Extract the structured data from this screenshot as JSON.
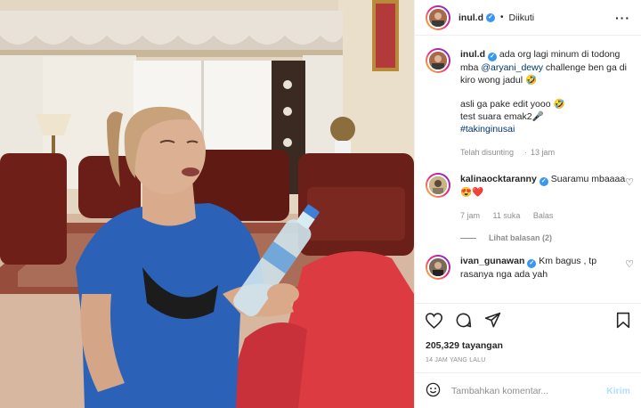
{
  "post": {
    "username": "inul.d",
    "follow_state": "Diikuti",
    "caption_line1": "ada org lagi minum di todong mba ",
    "caption_mention": "@aryani_dewy",
    "caption_line2": " challenge ben ga di kiro wong jadul 🤣",
    "caption_extra1": "asli ga pake edit yooo 🤣",
    "caption_extra2": "test suara emak2🎤",
    "caption_hashtag": "#takinginusai",
    "caption_meta_edited": "Telah disunting",
    "caption_meta_time": "13 jam"
  },
  "comments": [
    {
      "username": "kalinaocktaranny",
      "text": " Suaramu mbaaaa 😍❤️",
      "time": "7 jam",
      "likes": "11 suka",
      "reply": "Balas",
      "view_replies": "Lihat balasan (2)"
    },
    {
      "username": "ivan_gunawan",
      "text": " Km bagus , tp rasanya nga ada yah"
    }
  ],
  "footer": {
    "views": "205,329 tayangan",
    "timestamp": "14 JAM YANG LALU",
    "comment_placeholder": "Tambahkan komentar...",
    "post_label": "Kirim"
  },
  "icons": {
    "verified": "verified-badge-icon",
    "more": "more-options-icon",
    "like": "heart-icon",
    "comment": "comment-icon",
    "share": "share-icon",
    "save": "bookmark-icon",
    "emoji": "emoji-icon"
  },
  "colors": {
    "verified_blue": "#3897f0",
    "link": "#00376b",
    "muted": "#8e8e8e",
    "post_button_disabled": "#b2dffc"
  }
}
